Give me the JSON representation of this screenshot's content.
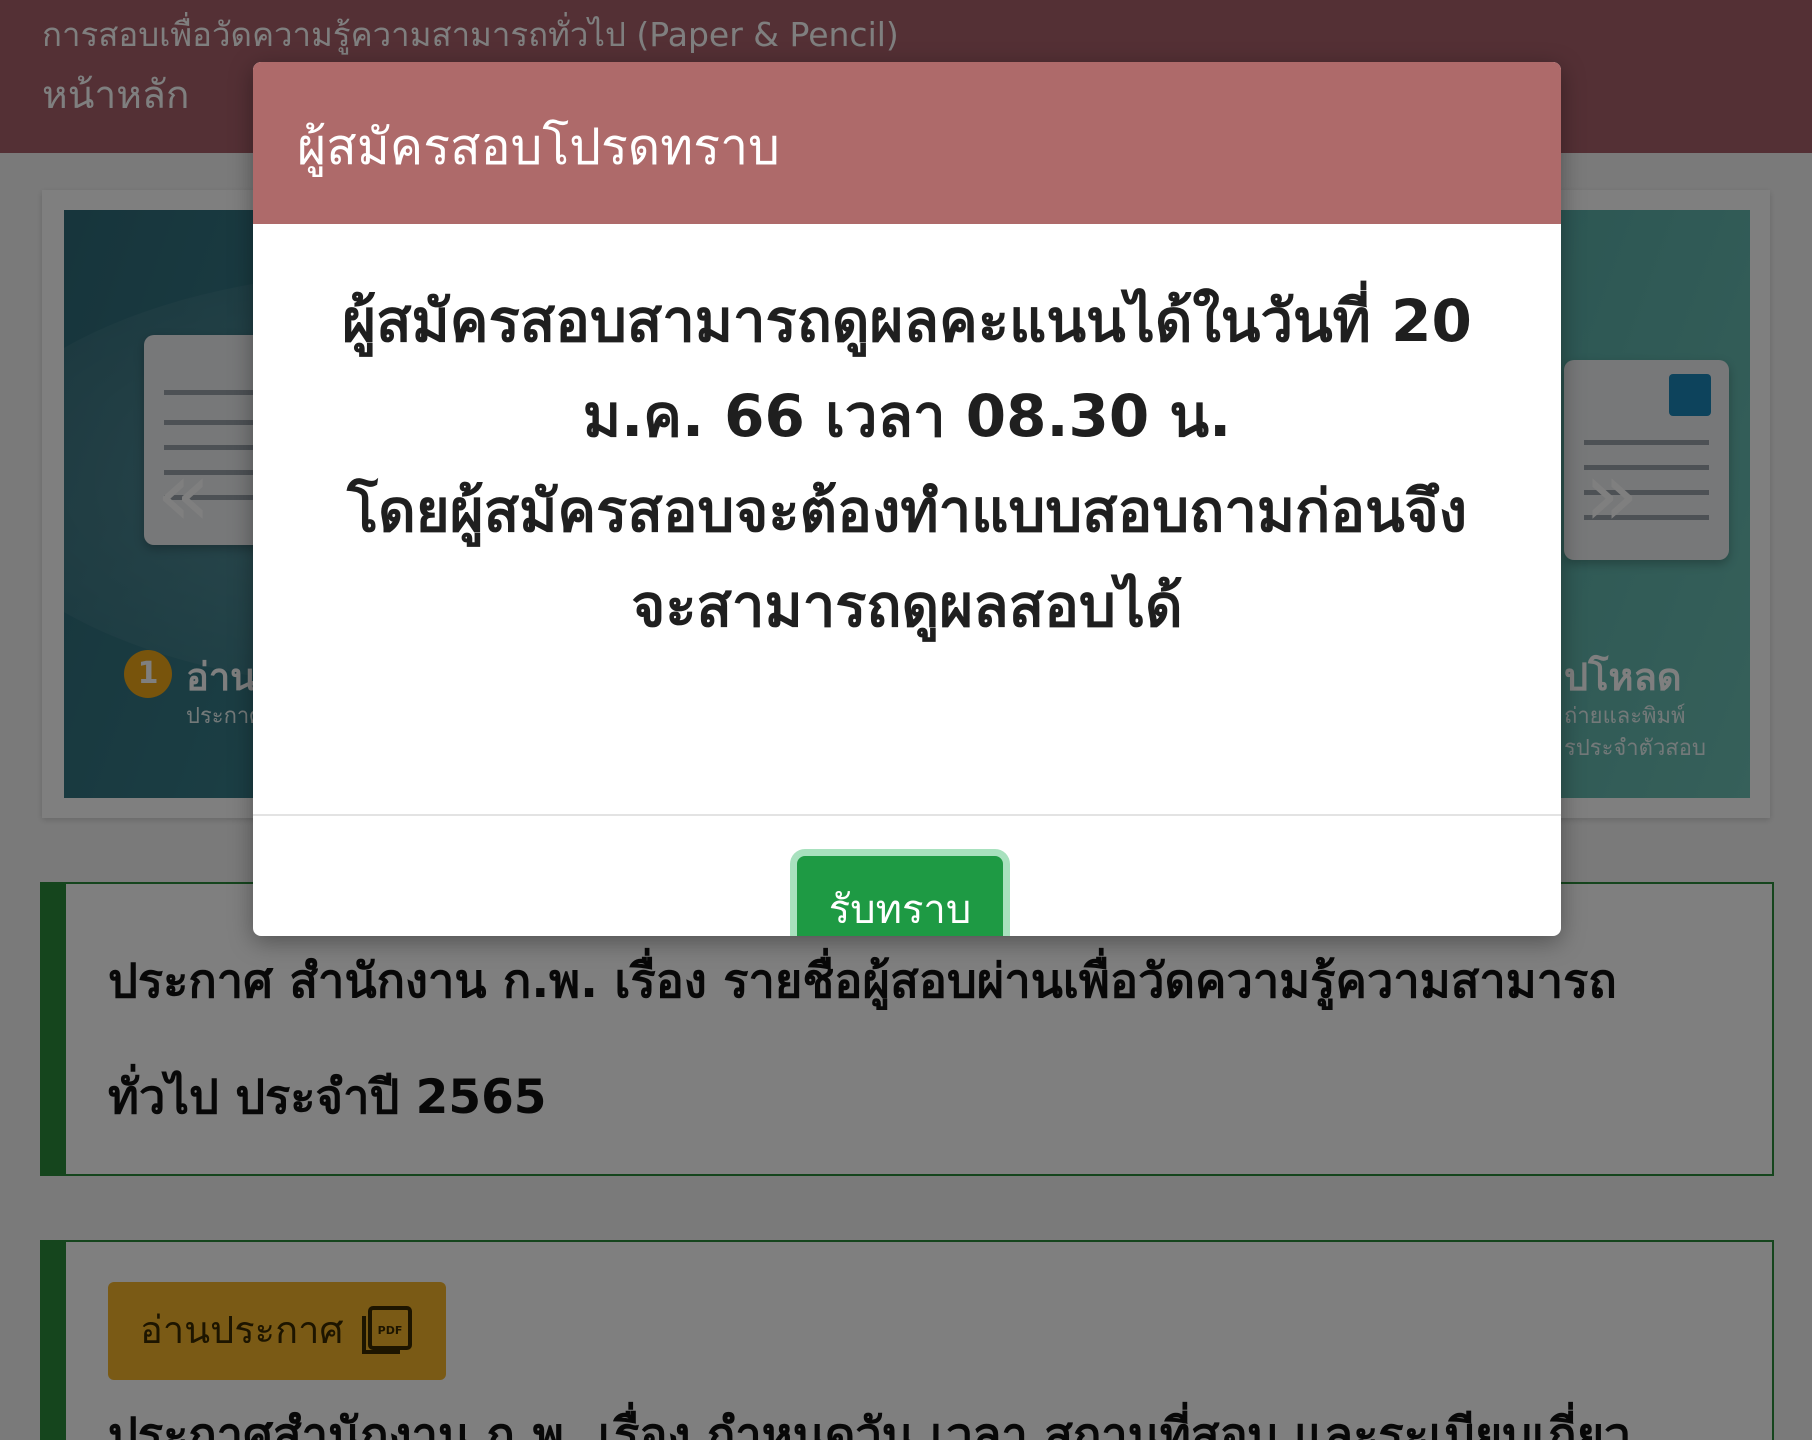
{
  "topbar": {
    "subtitle": "การสอบเพื่อวัดความรู้ความสามารถทั่วไป (Paper & Pencil)",
    "home": "หน้าหลัก"
  },
  "carousel": {
    "prev_icon": "chevron-double-left-icon",
    "next_icon": "chevron-double-right-icon",
    "step1": {
      "number": "1",
      "title": "อ่าน",
      "desc": "ประกาศ"
    },
    "step3": {
      "title": "ปโหลด",
      "desc_line1": "ถ่ายและพิมพ์",
      "desc_line2": "รประจำตัวสอบ"
    }
  },
  "announcements": [
    {
      "text": "ประกาศ สำนักงาน ก.พ. เรื่อง รายชื่อผู้สอบผ่านเพื่อวัดความรู้ความสามารถทั่วไป ประจำปี 2565"
    },
    {
      "button_label": "อ่านประกาศ",
      "button_icon": "pdf-icon",
      "text": "ประกาศสำนักงาน ก.พ. เรื่อง กำหนดวัน เวลา สถานที่สอบ และระเบียบเกี่ยว"
    }
  ],
  "modal": {
    "title": "ผู้สมัครสอบโปรดทราบ",
    "message_lines": [
      "ผู้สมัครสอบสามารถดูผลคะแนนได้ในวันที่ 20",
      "ม.ค. 66 เวลา 08.30 น.",
      "โดยผู้สมัครสอบจะต้องทำแบบสอบถามก่อนจึง",
      "จะสามารถดูผลสอบได้"
    ],
    "ack_button": "รับทราบ"
  },
  "colors": {
    "topbar": "#a8606a",
    "modal_header": "#ae6a6a",
    "ack_button": "#1e9a44",
    "announce_border": "#2a8a3a",
    "read_button": "#f5b52a"
  }
}
